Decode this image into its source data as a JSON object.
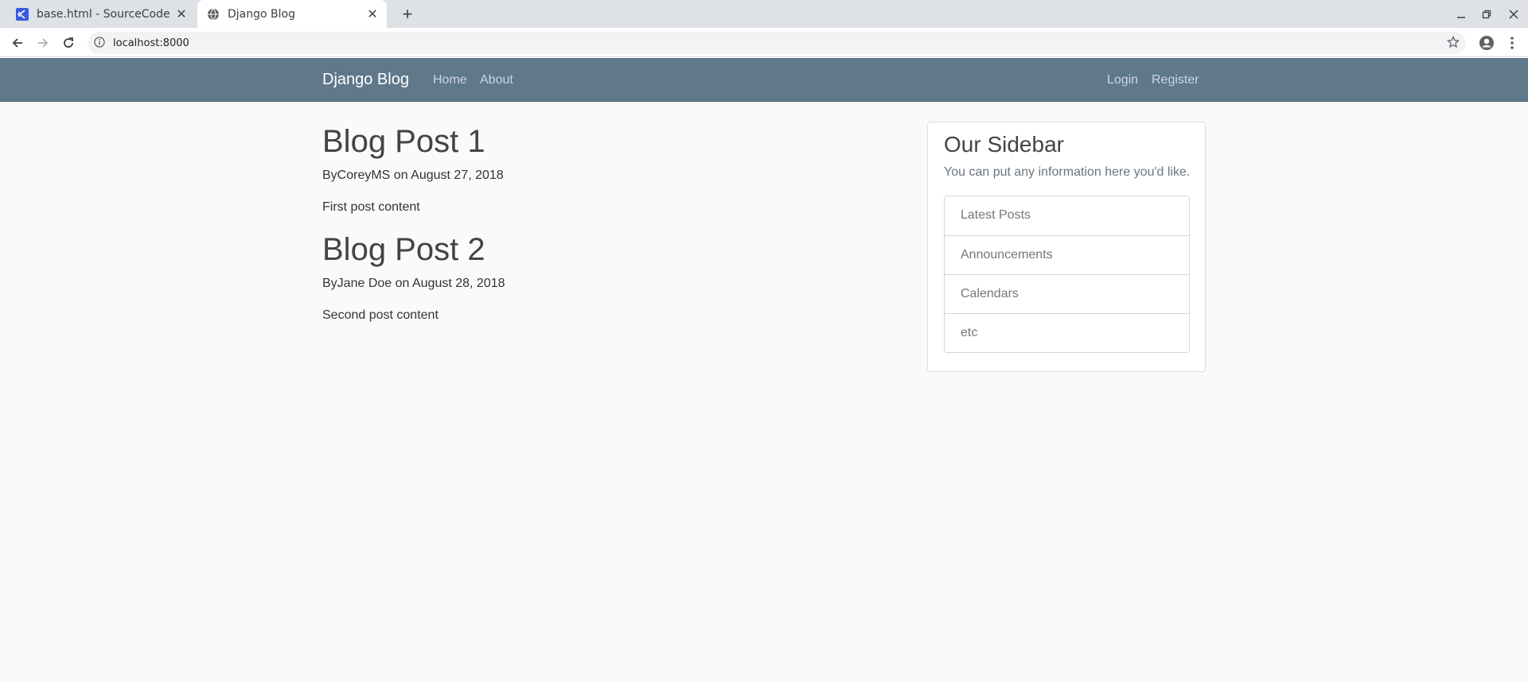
{
  "browser": {
    "tabs": [
      {
        "title": "base.html - SourceCode -",
        "active": false,
        "icon": "vscode-icon"
      },
      {
        "title": "Django Blog",
        "active": true,
        "icon": "globe-icon"
      }
    ],
    "url": "localhost:8000"
  },
  "site": {
    "brand": "Django Blog",
    "nav_left": [
      "Home",
      "About"
    ],
    "nav_right": [
      "Login",
      "Register"
    ],
    "nav_color": "#5f788a"
  },
  "posts": [
    {
      "title": "Blog Post 1",
      "meta": "ByCoreyMS on August 27, 2018",
      "content": "First post content"
    },
    {
      "title": "Blog Post 2",
      "meta": "ByJane Doe on August 28, 2018",
      "content": "Second post content"
    }
  ],
  "sidebar": {
    "title": "Our Sidebar",
    "text": "You can put any information here you'd like.",
    "items": [
      "Latest Posts",
      "Announcements",
      "Calendars",
      "etc"
    ]
  }
}
